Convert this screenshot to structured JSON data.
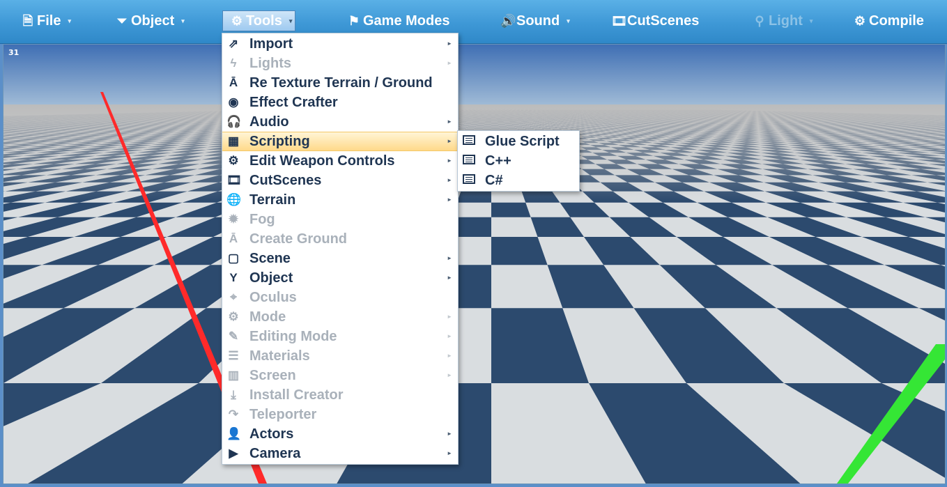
{
  "menubar": {
    "items": [
      {
        "label": "File",
        "icon": "file-icon",
        "glyph": "🗎",
        "state": "normal"
      },
      {
        "label": "Object",
        "icon": "filter-icon",
        "glyph": "⏷",
        "state": "normal"
      },
      {
        "label": "Tools",
        "icon": "gears-icon",
        "glyph": "⚙",
        "state": "active"
      },
      {
        "label": "Game Modes",
        "icon": "flag-icon",
        "glyph": "⚑",
        "state": "normal"
      },
      {
        "label": "Sound",
        "icon": "speaker-icon",
        "glyph": "🔊",
        "state": "normal"
      },
      {
        "label": "CutScenes",
        "icon": "film-icon",
        "glyph": "🎞",
        "state": "normal"
      },
      {
        "label": "Light",
        "icon": "lightbulb-icon",
        "glyph": "⚲",
        "state": "disabled"
      },
      {
        "label": "Compile",
        "icon": "gear-icon",
        "glyph": "⚙",
        "state": "normal"
      }
    ]
  },
  "viewport": {
    "fps": "31"
  },
  "tools_menu": {
    "items": [
      {
        "label": "Import",
        "icon": "share-icon",
        "glyph": "⇗",
        "submenu": true,
        "disabled": false
      },
      {
        "label": "Lights",
        "icon": "bolt-icon",
        "glyph": "ϟ",
        "submenu": true,
        "disabled": true
      },
      {
        "label": "Re Texture Terrain / Ground",
        "icon": "road-icon",
        "glyph": "Ā",
        "submenu": false,
        "disabled": false
      },
      {
        "label": "Effect Crafter",
        "icon": "eye-icon",
        "glyph": "◉",
        "submenu": false,
        "disabled": false
      },
      {
        "label": "Audio",
        "icon": "headphones-icon",
        "glyph": "🎧",
        "submenu": true,
        "disabled": false
      },
      {
        "label": "Scripting",
        "icon": "table-icon",
        "glyph": "▦",
        "submenu": true,
        "disabled": false,
        "hover": true
      },
      {
        "label": "Edit Weapon Controls",
        "icon": "cog-icon",
        "glyph": "⚙",
        "submenu": true,
        "disabled": false
      },
      {
        "label": "CutScenes",
        "icon": "film-icon",
        "glyph": "🎞",
        "submenu": true,
        "disabled": false
      },
      {
        "label": "Terrain",
        "icon": "globe-icon",
        "glyph": "🌐",
        "submenu": true,
        "disabled": false
      },
      {
        "label": "Fog",
        "icon": "certificate-icon",
        "glyph": "✹",
        "submenu": false,
        "disabled": true
      },
      {
        "label": "Create Ground",
        "icon": "road-icon",
        "glyph": "Ā",
        "submenu": false,
        "disabled": true
      },
      {
        "label": "Scene",
        "icon": "square-icon",
        "glyph": "▢",
        "submenu": true,
        "disabled": false
      },
      {
        "label": "Object",
        "icon": "filter-icon",
        "glyph": "Y",
        "submenu": true,
        "disabled": false
      },
      {
        "label": "Oculus",
        "icon": "crosshair-icon",
        "glyph": "⌖",
        "submenu": false,
        "disabled": true
      },
      {
        "label": "Mode",
        "icon": "cog-icon",
        "glyph": "⚙",
        "submenu": true,
        "disabled": true
      },
      {
        "label": "Editing Mode",
        "icon": "pencil-icon",
        "glyph": "✎",
        "submenu": true,
        "disabled": true
      },
      {
        "label": "Materials",
        "icon": "list-icon",
        "glyph": "☰",
        "submenu": true,
        "disabled": true
      },
      {
        "label": "Screen",
        "icon": "bar-chart-icon",
        "glyph": "▥",
        "submenu": true,
        "disabled": true
      },
      {
        "label": "Install Creator",
        "icon": "download-icon",
        "glyph": "⤓",
        "submenu": false,
        "disabled": true
      },
      {
        "label": "Teleporter",
        "icon": "forward-arrow-icon",
        "glyph": "↷",
        "submenu": false,
        "disabled": true
      },
      {
        "label": "Actors",
        "icon": "user-icon",
        "glyph": "👤",
        "submenu": true,
        "disabled": false
      },
      {
        "label": "Camera",
        "icon": "video-camera-icon",
        "glyph": "▶",
        "submenu": true,
        "disabled": false
      }
    ]
  },
  "scripting_submenu": {
    "items": [
      {
        "label": "Glue Script",
        "icon": "list-alt-icon"
      },
      {
        "label": "C++",
        "icon": "list-alt-icon"
      },
      {
        "label": "C#",
        "icon": "list-alt-icon"
      }
    ]
  },
  "colors": {
    "menubar": "#3e98d6",
    "menu_text": "#1f3552",
    "disabled_text": "#a9b1ba",
    "hover_highlight": "#ffd98a",
    "x_axis": "#ff2a2a",
    "y_axis": "#35e635",
    "tile_dark": "#2c4a6e",
    "tile_light": "#d9dde0"
  }
}
